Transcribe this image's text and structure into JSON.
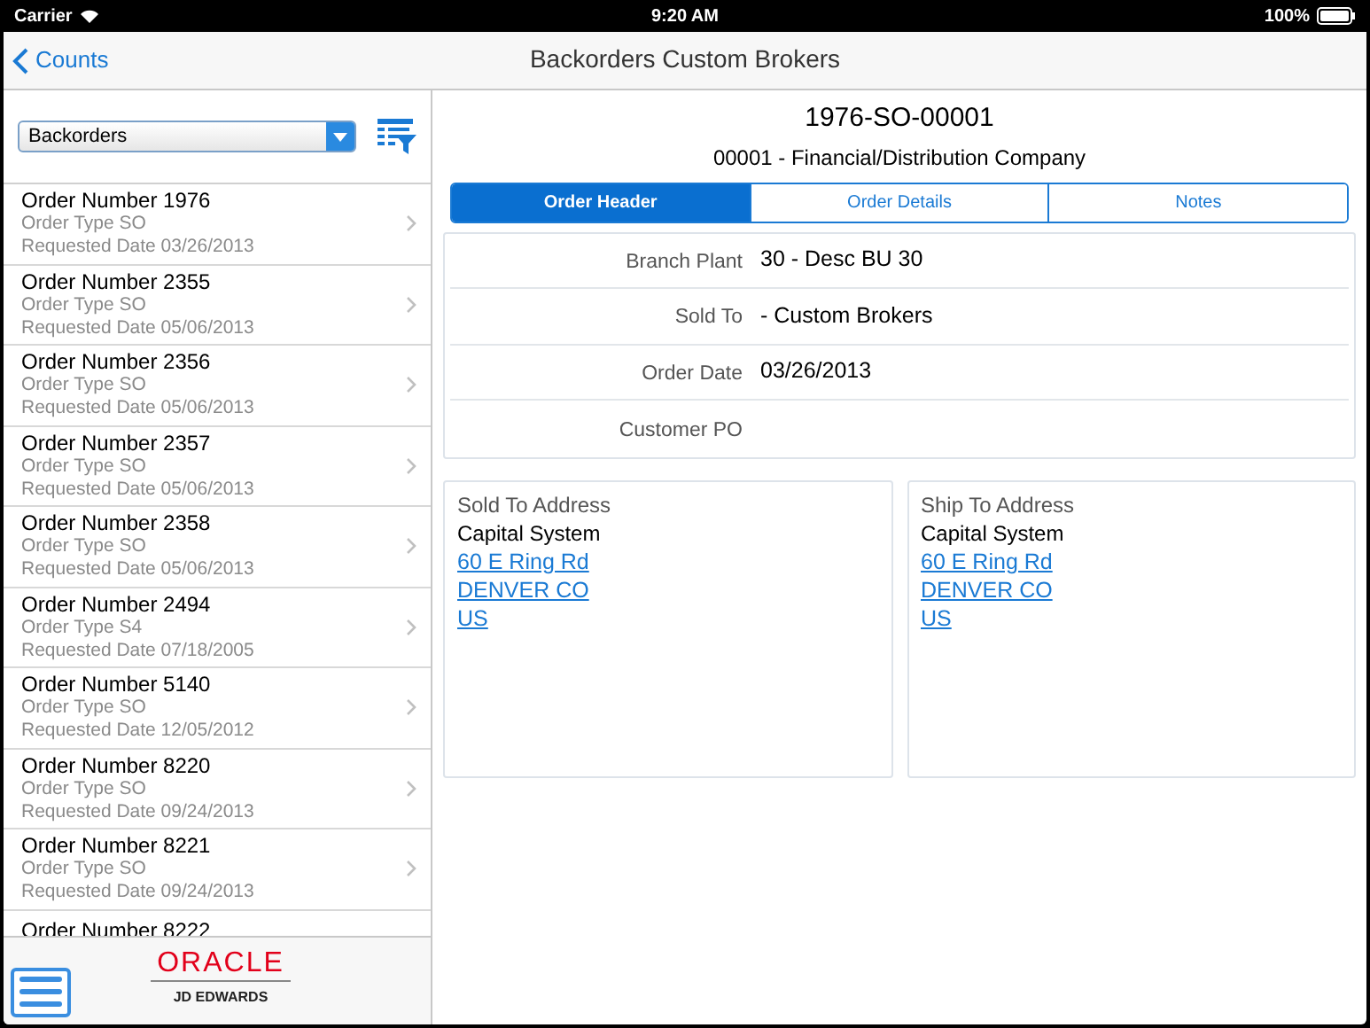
{
  "status_bar": {
    "carrier": "Carrier",
    "time": "9:20 AM",
    "battery": "100%"
  },
  "nav_bar": {
    "back": "Counts",
    "title": "Backorders Custom Brokers"
  },
  "sidebar": {
    "filter": {
      "value": "Backorders"
    },
    "orders": [
      {
        "title": "Order Number 1976",
        "type": "Order Type SO",
        "date": "Requested Date 03/26/2013",
        "selected": false
      },
      {
        "title": "Order Number 2355",
        "type": "Order Type SO",
        "date": "Requested Date 05/06/2013",
        "selected": false
      },
      {
        "title": "Order Number 2356",
        "type": "Order Type SO",
        "date": "Requested Date 05/06/2013",
        "selected": false
      },
      {
        "title": "Order Number 2357",
        "type": "Order Type SO",
        "date": "Requested Date 05/06/2013",
        "selected": false
      },
      {
        "title": "Order Number 2358",
        "type": "Order Type SO",
        "date": "Requested Date 05/06/2013",
        "selected": false
      },
      {
        "title": "Order Number 2494",
        "type": "Order Type S4",
        "date": "Requested Date 07/18/2005",
        "selected": false
      },
      {
        "title": "Order Number 5140",
        "type": "Order Type SO",
        "date": "Requested Date 12/05/2012",
        "selected": false
      },
      {
        "title": "Order Number 8220",
        "type": "Order Type SO",
        "date": "Requested Date 09/24/2013",
        "selected": false
      },
      {
        "title": "Order Number 8221",
        "type": "Order Type SO",
        "date": "Requested Date 09/24/2013",
        "selected": false
      },
      {
        "title": "Order Number 8222",
        "selected": false
      }
    ],
    "logo": {
      "brand": "ORACLE",
      "product": "JD EDWARDS"
    }
  },
  "detail": {
    "order_id": "1976-SO-00001",
    "company": "00001 - Financial/Distribution Company",
    "tabs": [
      {
        "label": "Order Header",
        "selected": true
      },
      {
        "label": "Order Details",
        "selected": false
      },
      {
        "label": "Notes",
        "selected": false
      }
    ],
    "fields": [
      {
        "label": "Branch Plant",
        "value": "30 - Desc BU 30"
      },
      {
        "label": "Sold To",
        "value": "- Custom Brokers"
      },
      {
        "label": "Order Date",
        "value": "03/26/2013"
      },
      {
        "label": "Customer PO"
      }
    ],
    "addresses": [
      {
        "heading": "Sold To Address",
        "name": "Capital System",
        "lines": [
          "60 E Ring Rd",
          "DENVER CO",
          "US"
        ]
      },
      {
        "heading": "Ship To Address",
        "name": "Capital System",
        "lines": [
          "60 E Ring Rd",
          "DENVER CO",
          "US"
        ]
      }
    ]
  }
}
